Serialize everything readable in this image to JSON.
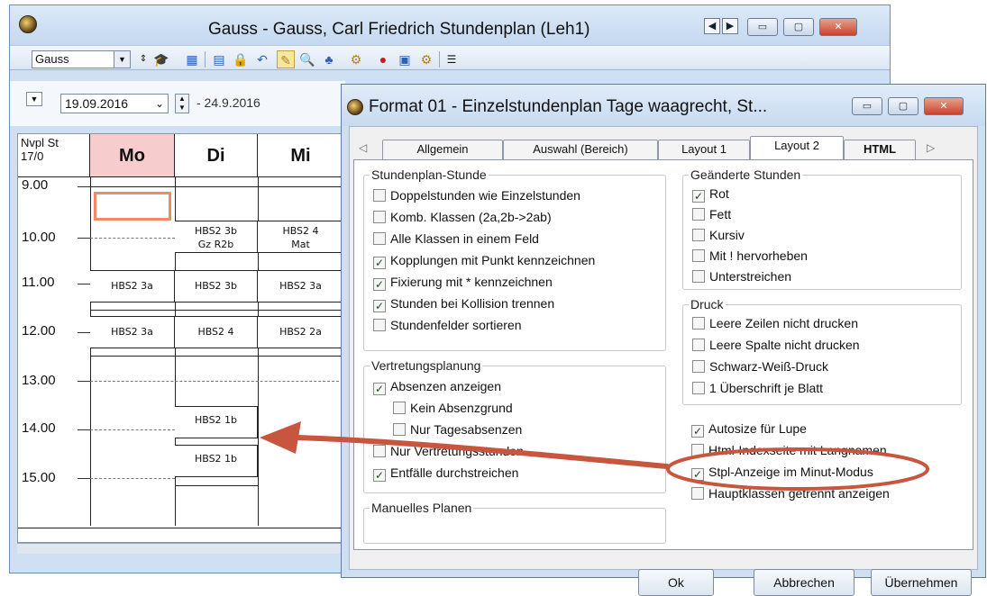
{
  "main_window": {
    "title": "Gauss - Gauss, Carl Friedrich  Stundenplan  (Leh1)"
  },
  "toolbar": {
    "teacher_combo": "Gauss"
  },
  "datebar": {
    "start_date": "19.09.2016",
    "end_date": "- 24.9.2016"
  },
  "timetable": {
    "corner": {
      "line1": "Nvpl St",
      "line2": "17/0"
    },
    "days": [
      "Mo",
      "Di",
      "Mi"
    ],
    "times": [
      "9.00",
      "10.00",
      "11.00",
      "12.00",
      "13.00",
      "14.00",
      "15.00"
    ],
    "cells": {
      "di_10": {
        "line1": "HBS2 3b",
        "line2": "Gz R2b"
      },
      "mi_10": {
        "line1": "HBS2 4",
        "line2": "Mat"
      },
      "mo_11": "HBS2 3a",
      "di_11": "HBS2 3b",
      "mi_11": "HBS2 3a",
      "mo_12": "HBS2 3a",
      "di_12": "HBS2 4",
      "mi_12": "HBS2 2a",
      "di_14": "HBS2 1b",
      "di_15": "HBS2 1b"
    }
  },
  "dialog": {
    "title": "Format 01 - Einzelstundenplan Tage waagrecht, St...",
    "tabs": [
      "Allgemein",
      "Auswahl (Bereich)",
      "Layout 1",
      "Layout 2",
      "HTML"
    ],
    "group_stunde": {
      "title": "Stundenplan-Stunde",
      "items": [
        {
          "label": "Doppelstunden wie Einzelstunden",
          "checked": ""
        },
        {
          "label": "Komb. Klassen (2a,2b->2ab)",
          "checked": ""
        },
        {
          "label": "Alle Klassen in einem Feld",
          "checked": ""
        },
        {
          "label": "Kopplungen mit Punkt kennzeichnen",
          "checked": "✓"
        },
        {
          "label": "Fixierung mit * kennzeichnen",
          "checked": "✓"
        },
        {
          "label": "Stunden bei Kollision trennen",
          "checked": "✓"
        },
        {
          "label": "Stundenfelder sortieren",
          "checked": ""
        }
      ]
    },
    "group_vertretung": {
      "title": "Vertretungsplanung",
      "items": [
        {
          "label": "Absenzen anzeigen",
          "checked": "✓"
        },
        {
          "label": "Kein Absenzgrund",
          "checked": ""
        },
        {
          "label": "Nur Tagesabsenzen",
          "checked": ""
        },
        {
          "label": "Nur Vertretungsstunden",
          "checked": ""
        },
        {
          "label": "Entfälle durchstreichen",
          "checked": "✓"
        }
      ]
    },
    "group_manuell": {
      "title": "Manuelles Planen"
    },
    "group_geaendert": {
      "title": "Geänderte Stunden",
      "items": [
        {
          "label": "Rot",
          "checked": "✓"
        },
        {
          "label": "Fett",
          "checked": ""
        },
        {
          "label": "Kursiv",
          "checked": ""
        },
        {
          "label": "Mit ! hervorheben",
          "checked": ""
        },
        {
          "label": "Unterstreichen",
          "checked": ""
        }
      ]
    },
    "group_druck": {
      "title": "Druck",
      "items": [
        {
          "label": "Leere Zeilen nicht drucken",
          "checked": ""
        },
        {
          "label": "Leere Spalte nicht drucken",
          "checked": ""
        },
        {
          "label": "Schwarz-Weiß-Druck",
          "checked": ""
        },
        {
          "label": "1 Überschrift je Blatt",
          "checked": ""
        }
      ]
    },
    "extra": [
      {
        "label": "Autosize für Lupe",
        "checked": "✓"
      },
      {
        "label": "Html-Indexseite mit Langnamen",
        "checked": ""
      },
      {
        "label": "Stpl-Anzeige im Minut-Modus",
        "checked": "✓"
      },
      {
        "label": "Hauptklassen getrennt anzeigen",
        "checked": ""
      }
    ],
    "buttons": {
      "ok": "Ok",
      "cancel": "Abbrechen",
      "apply": "Übernehmen"
    }
  },
  "colors": {
    "highlight": "#c8553d",
    "monday_header": "#f7cccc",
    "accent": "#5b7da6"
  }
}
